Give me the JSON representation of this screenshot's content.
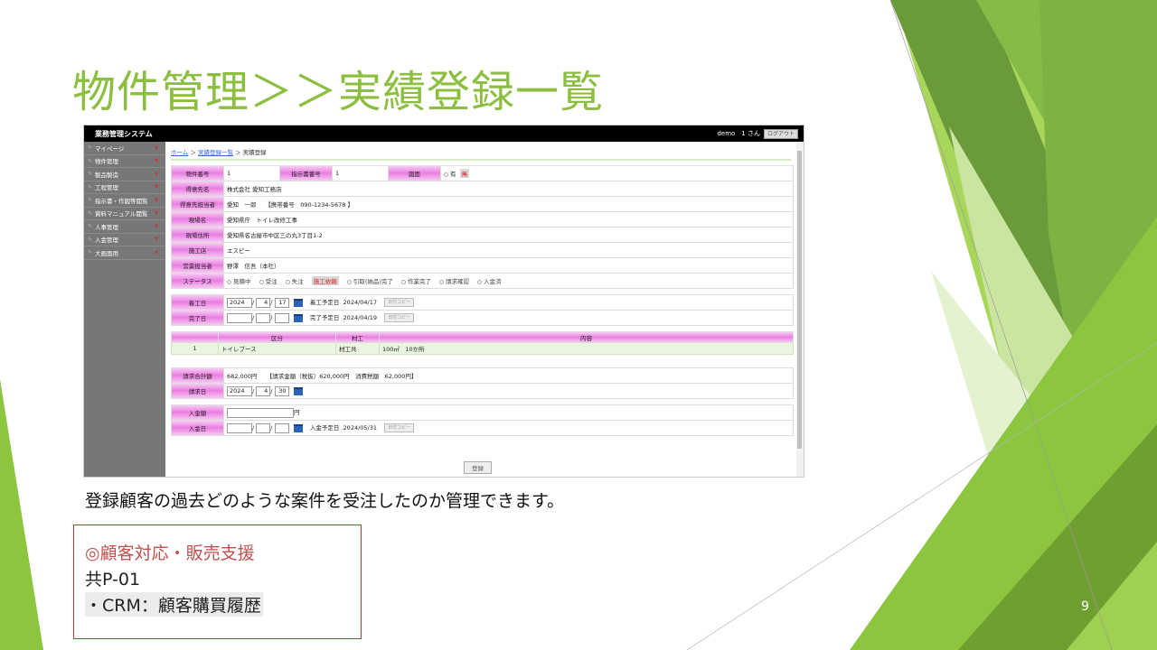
{
  "slide": {
    "title": "物件管理＞＞実績登録一覧",
    "caption": "登録顧客の過去どのような案件を受注したのか管理できます。",
    "note_heading": "◎顧客対応・販売支援",
    "note_code": "共P-01",
    "note_item": "・CRM：顧客購買履歴",
    "page_number": "9"
  },
  "app": {
    "name": "業務管理システム",
    "user": "demo　1 さん",
    "logout_label": "ログアウト"
  },
  "sidebar": {
    "items": [
      {
        "label": "マイページ"
      },
      {
        "label": "物件管理"
      },
      {
        "label": "製品製造"
      },
      {
        "label": "工程管理"
      },
      {
        "label": "指示書・作図等閲覧"
      },
      {
        "label": "資料マニュアル閲覧"
      },
      {
        "label": "人事管理"
      },
      {
        "label": "入金管理"
      },
      {
        "label": "大画面用"
      }
    ]
  },
  "breadcrumb": {
    "home": "ホーム",
    "list": "実績登録一覧",
    "current": "実績登録",
    "sep": "＞"
  },
  "form": {
    "bukken_label": "物件番号",
    "bukken_value": "1",
    "shiji_label": "指示書番号",
    "shiji_value": "1",
    "zumen_label": "図面",
    "zumen_yes": "有",
    "zumen_no": "無",
    "client_label": "得意先名",
    "client_value": "株式会社 愛知工務店",
    "contact_label": "得意先担当者",
    "contact_value": "愛知　一郎　　【携帯番号　090-1234-5678 】",
    "site_label": "現場名",
    "site_value": "愛知県庁　トイレ改修工事",
    "address_label": "現場住所",
    "address_value": "愛知県名古屋市中区三の丸3丁目1-2",
    "contractor_label": "施工店",
    "contractor_value": "エスピー",
    "sales_label": "営業担当者",
    "sales_value": "野澤　信吾（本社）",
    "status_label": "ステータス",
    "statuses": [
      "見積中",
      "受注",
      "失注",
      "施工依頼",
      "引取(納品)完了",
      "作業完了",
      "請求確認",
      "入金済"
    ],
    "status_selected": "施工依頼"
  },
  "dates": {
    "start_label": "着工日",
    "start_year": "2024",
    "start_month": "4",
    "start_day": "17",
    "start_plan_label": "着工予定日",
    "start_plan_value": "2024/04/17",
    "end_label": "完了日",
    "end_plan_label": "完了予定日",
    "end_plan_value": "2024/04/19",
    "copy_label": "日付コピー",
    "sep": "/"
  },
  "items_table": {
    "headers": [
      "",
      "区分",
      "材工",
      "内容"
    ],
    "rows": [
      [
        "1",
        "トイレブース",
        "材工共",
        "100㎡　10か所"
      ]
    ]
  },
  "billing": {
    "total_label": "請求合計額",
    "total_value": "682,000円",
    "breakdown": "【請求金額（税抜）620,000円　消費税額　62,000円】",
    "bill_date_label": "請求日",
    "bill_year": "2024",
    "bill_month": "4",
    "bill_day": "30"
  },
  "payment": {
    "amount_label": "入金額",
    "yen": "円",
    "date_label": "入金日",
    "plan_label": "入金予定日",
    "plan_value": "2024/05/31"
  },
  "register_label": "登録",
  "colors": {
    "title_green": "#8cbf3f",
    "label_pink": "#ea7ee2",
    "note_red": "#c0504d",
    "box_border": "#d72b2b"
  }
}
